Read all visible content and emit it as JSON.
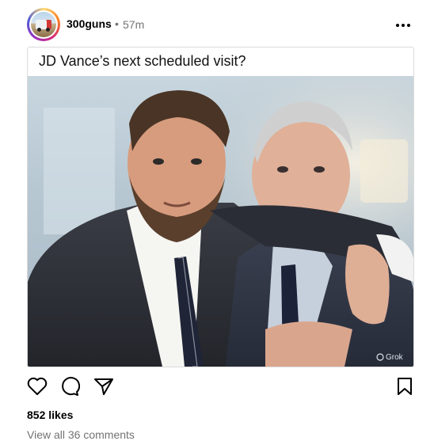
{
  "post": {
    "username": "300guns",
    "separator": "•",
    "time_ago": "57m",
    "caption": "JD Vance’s next scheduled visit?",
    "image_watermark": "Grok",
    "likes": "852 likes",
    "view_comments": "View all 36 comments"
  },
  "icons": {
    "more": "more-horizontal-icon",
    "like": "heart-icon",
    "comment": "comment-icon",
    "share": "paper-plane-icon",
    "save": "bookmark-icon"
  },
  "colors": {
    "secondary_text": "#737373",
    "border": "#dbdbdb"
  }
}
